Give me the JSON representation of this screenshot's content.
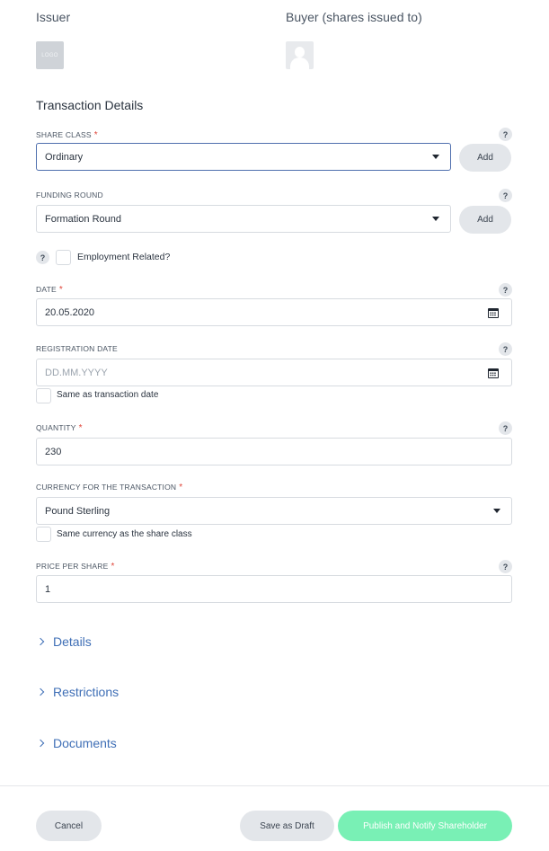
{
  "parties": {
    "issuer_label": "Issuer",
    "issuer_logo_text": "LOGO",
    "buyer_label": "Buyer (shares issued to)"
  },
  "transaction": {
    "title": "Transaction Details",
    "required_mark": "*",
    "help_symbol": "?",
    "share_class": {
      "label": "SHARE CLASS",
      "value": "Ordinary",
      "add_label": "Add"
    },
    "funding_round": {
      "label": "FUNDING ROUND",
      "value": "Formation Round",
      "add_label": "Add"
    },
    "employment": {
      "label": "Employment Related?",
      "checked": false
    },
    "date": {
      "label": "DATE",
      "value": "20.05.2020"
    },
    "registration_date": {
      "label": "REGISTRATION DATE",
      "placeholder": "DD.MM.YYYY",
      "same_label": "Same as transaction date"
    },
    "quantity": {
      "label": "QUANTITY",
      "value": "230"
    },
    "currency": {
      "label": "CURRENCY FOR THE TRANSACTION",
      "value": "Pound Sterling",
      "same_label": "Same currency as the share class"
    },
    "price": {
      "label": "PRICE PER SHARE",
      "value": "1"
    }
  },
  "sections": [
    {
      "label": "Details"
    },
    {
      "label": "Restrictions"
    },
    {
      "label": "Documents"
    }
  ],
  "footer": {
    "cancel_label": "Cancel",
    "draft_label": "Save as Draft",
    "publish_label": "Publish and Notify Shareholder"
  },
  "colors": {
    "accent_link": "#3f6fb6",
    "required": "#e0463a",
    "publish": "#79f0b5",
    "focus_border": "#4f6fae"
  }
}
